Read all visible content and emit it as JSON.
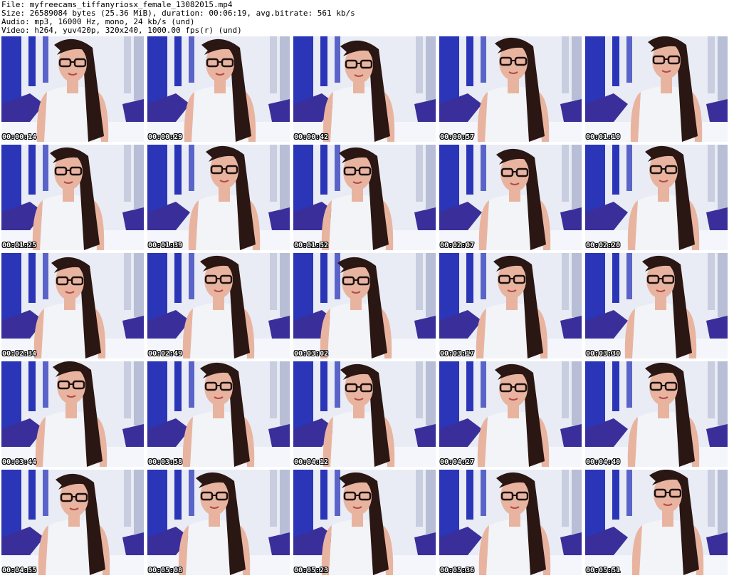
{
  "header": {
    "file": "File: myfreecams_tiffanyriosx_female_13082015.mp4",
    "size": "Size: 26589084 bytes (25.36 MiB), duration: 00:06:19, avg.bitrate: 561 kb/s",
    "audio": "Audio: mp3, 16000 Hz, mono, 24 kb/s (und)",
    "video": "Video: h264, yuv420p, 320x240, 1000.00 fps(r) (und)"
  },
  "frames": [
    {
      "time": "00:00:14"
    },
    {
      "time": "00:00:29"
    },
    {
      "time": "00:00:42"
    },
    {
      "time": "00:00:57"
    },
    {
      "time": "00:01:10"
    },
    {
      "time": "00:01:25"
    },
    {
      "time": "00:01:39"
    },
    {
      "time": "00:01:52"
    },
    {
      "time": "00:02:07"
    },
    {
      "time": "00:02:20"
    },
    {
      "time": "00:02:34"
    },
    {
      "time": "00:02:49"
    },
    {
      "time": "00:03:02"
    },
    {
      "time": "00:03:17"
    },
    {
      "time": "00:03:30"
    },
    {
      "time": "00:03:44"
    },
    {
      "time": "00:03:58"
    },
    {
      "time": "00:04:12"
    },
    {
      "time": "00:04:27"
    },
    {
      "time": "00:04:40"
    },
    {
      "time": "00:04:55"
    },
    {
      "time": "00:05:08"
    },
    {
      "time": "00:05:23"
    },
    {
      "time": "00:05:36"
    },
    {
      "time": "00:05:51"
    }
  ],
  "colors": {
    "wall_white": "#e9ecf4",
    "wall_blue": "#2a35b8",
    "bed_purple": "#3a2f9a",
    "bed_white": "#f4f6fb",
    "top_white": "#f2f4f8",
    "skin": "#e8b4a0",
    "hair": "#2a1612",
    "glasses": "#1a1010"
  }
}
